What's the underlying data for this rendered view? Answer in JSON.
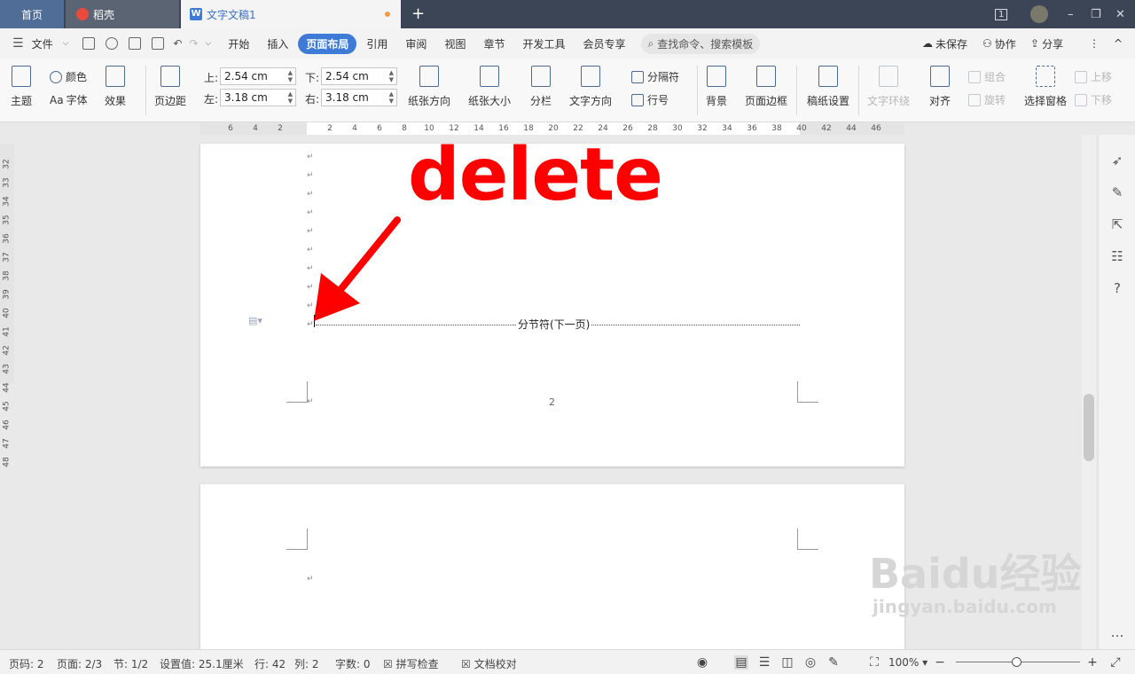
{
  "tabs": {
    "home": "首页",
    "daoke": "稻壳",
    "doc": "文字文稿1",
    "new": "+"
  },
  "window": {
    "page_count_badge": "1",
    "minimize": "–",
    "restore": "❐",
    "close": "✕"
  },
  "menu": {
    "file": "文件",
    "items": [
      "开始",
      "插入",
      "页面布局",
      "引用",
      "审阅",
      "视图",
      "章节",
      "开发工具",
      "会员专享"
    ],
    "active": "页面布局",
    "search": "查找命令、搜索模板",
    "unsaved": "未保存",
    "collab": "协作",
    "share": "分享",
    "more": "⋮",
    "collapse": "^"
  },
  "ribbon": {
    "theme": "主题",
    "color": "颜色",
    "font": "字体",
    "font_prefix": "Aa",
    "effect": "效果",
    "margin": "页边距",
    "top_label": "上:",
    "top_value": "2.54 cm",
    "bottom_label": "下:",
    "bottom_value": "2.54 cm",
    "left_label": "左:",
    "left_value": "3.18 cm",
    "right_label": "右:",
    "right_value": "3.18 cm",
    "orientation": "纸张方向",
    "size": "纸张大小",
    "columns": "分栏",
    "text_dir": "文字方向",
    "break": "分隔符",
    "line_num": "行号",
    "background": "背景",
    "page_border": "页面边框",
    "manuscript": "稿纸设置",
    "wrap": "文字环绕",
    "align": "对齐",
    "group": "组合",
    "rotate": "旋转",
    "select_pane": "选择窗格",
    "up": "上移",
    "down": "下移"
  },
  "ruler": {
    "ticks": [
      "6",
      "4",
      "2",
      "2",
      "4",
      "6",
      "8",
      "10",
      "12",
      "14",
      "16",
      "18",
      "20",
      "22",
      "24",
      "26",
      "28",
      "30",
      "32",
      "34",
      "36",
      "38",
      "40",
      "42",
      "44",
      "46"
    ],
    "vticks": [
      "32",
      "33",
      "34",
      "35",
      "36",
      "37",
      "38",
      "39",
      "40",
      "41",
      "42",
      "43",
      "44",
      "45",
      "46",
      "47",
      "48"
    ]
  },
  "doc": {
    "annotation": "delete",
    "section_break": "分节符(下一页)",
    "page_number": "2",
    "para_mark": "↵"
  },
  "status": {
    "page_no": "页码: 2",
    "pages": "页面: 2/3",
    "section": "节: 1/2",
    "setting": "设置值: 25.1厘米",
    "row": "行: 42",
    "col": "列: 2",
    "words": "字数: 0",
    "spell": "拼写检查",
    "proof": "文档校对",
    "zoom": "100%"
  },
  "watermark": {
    "brand": "Baidu经验",
    "url": "jingyan.baidu.com"
  }
}
